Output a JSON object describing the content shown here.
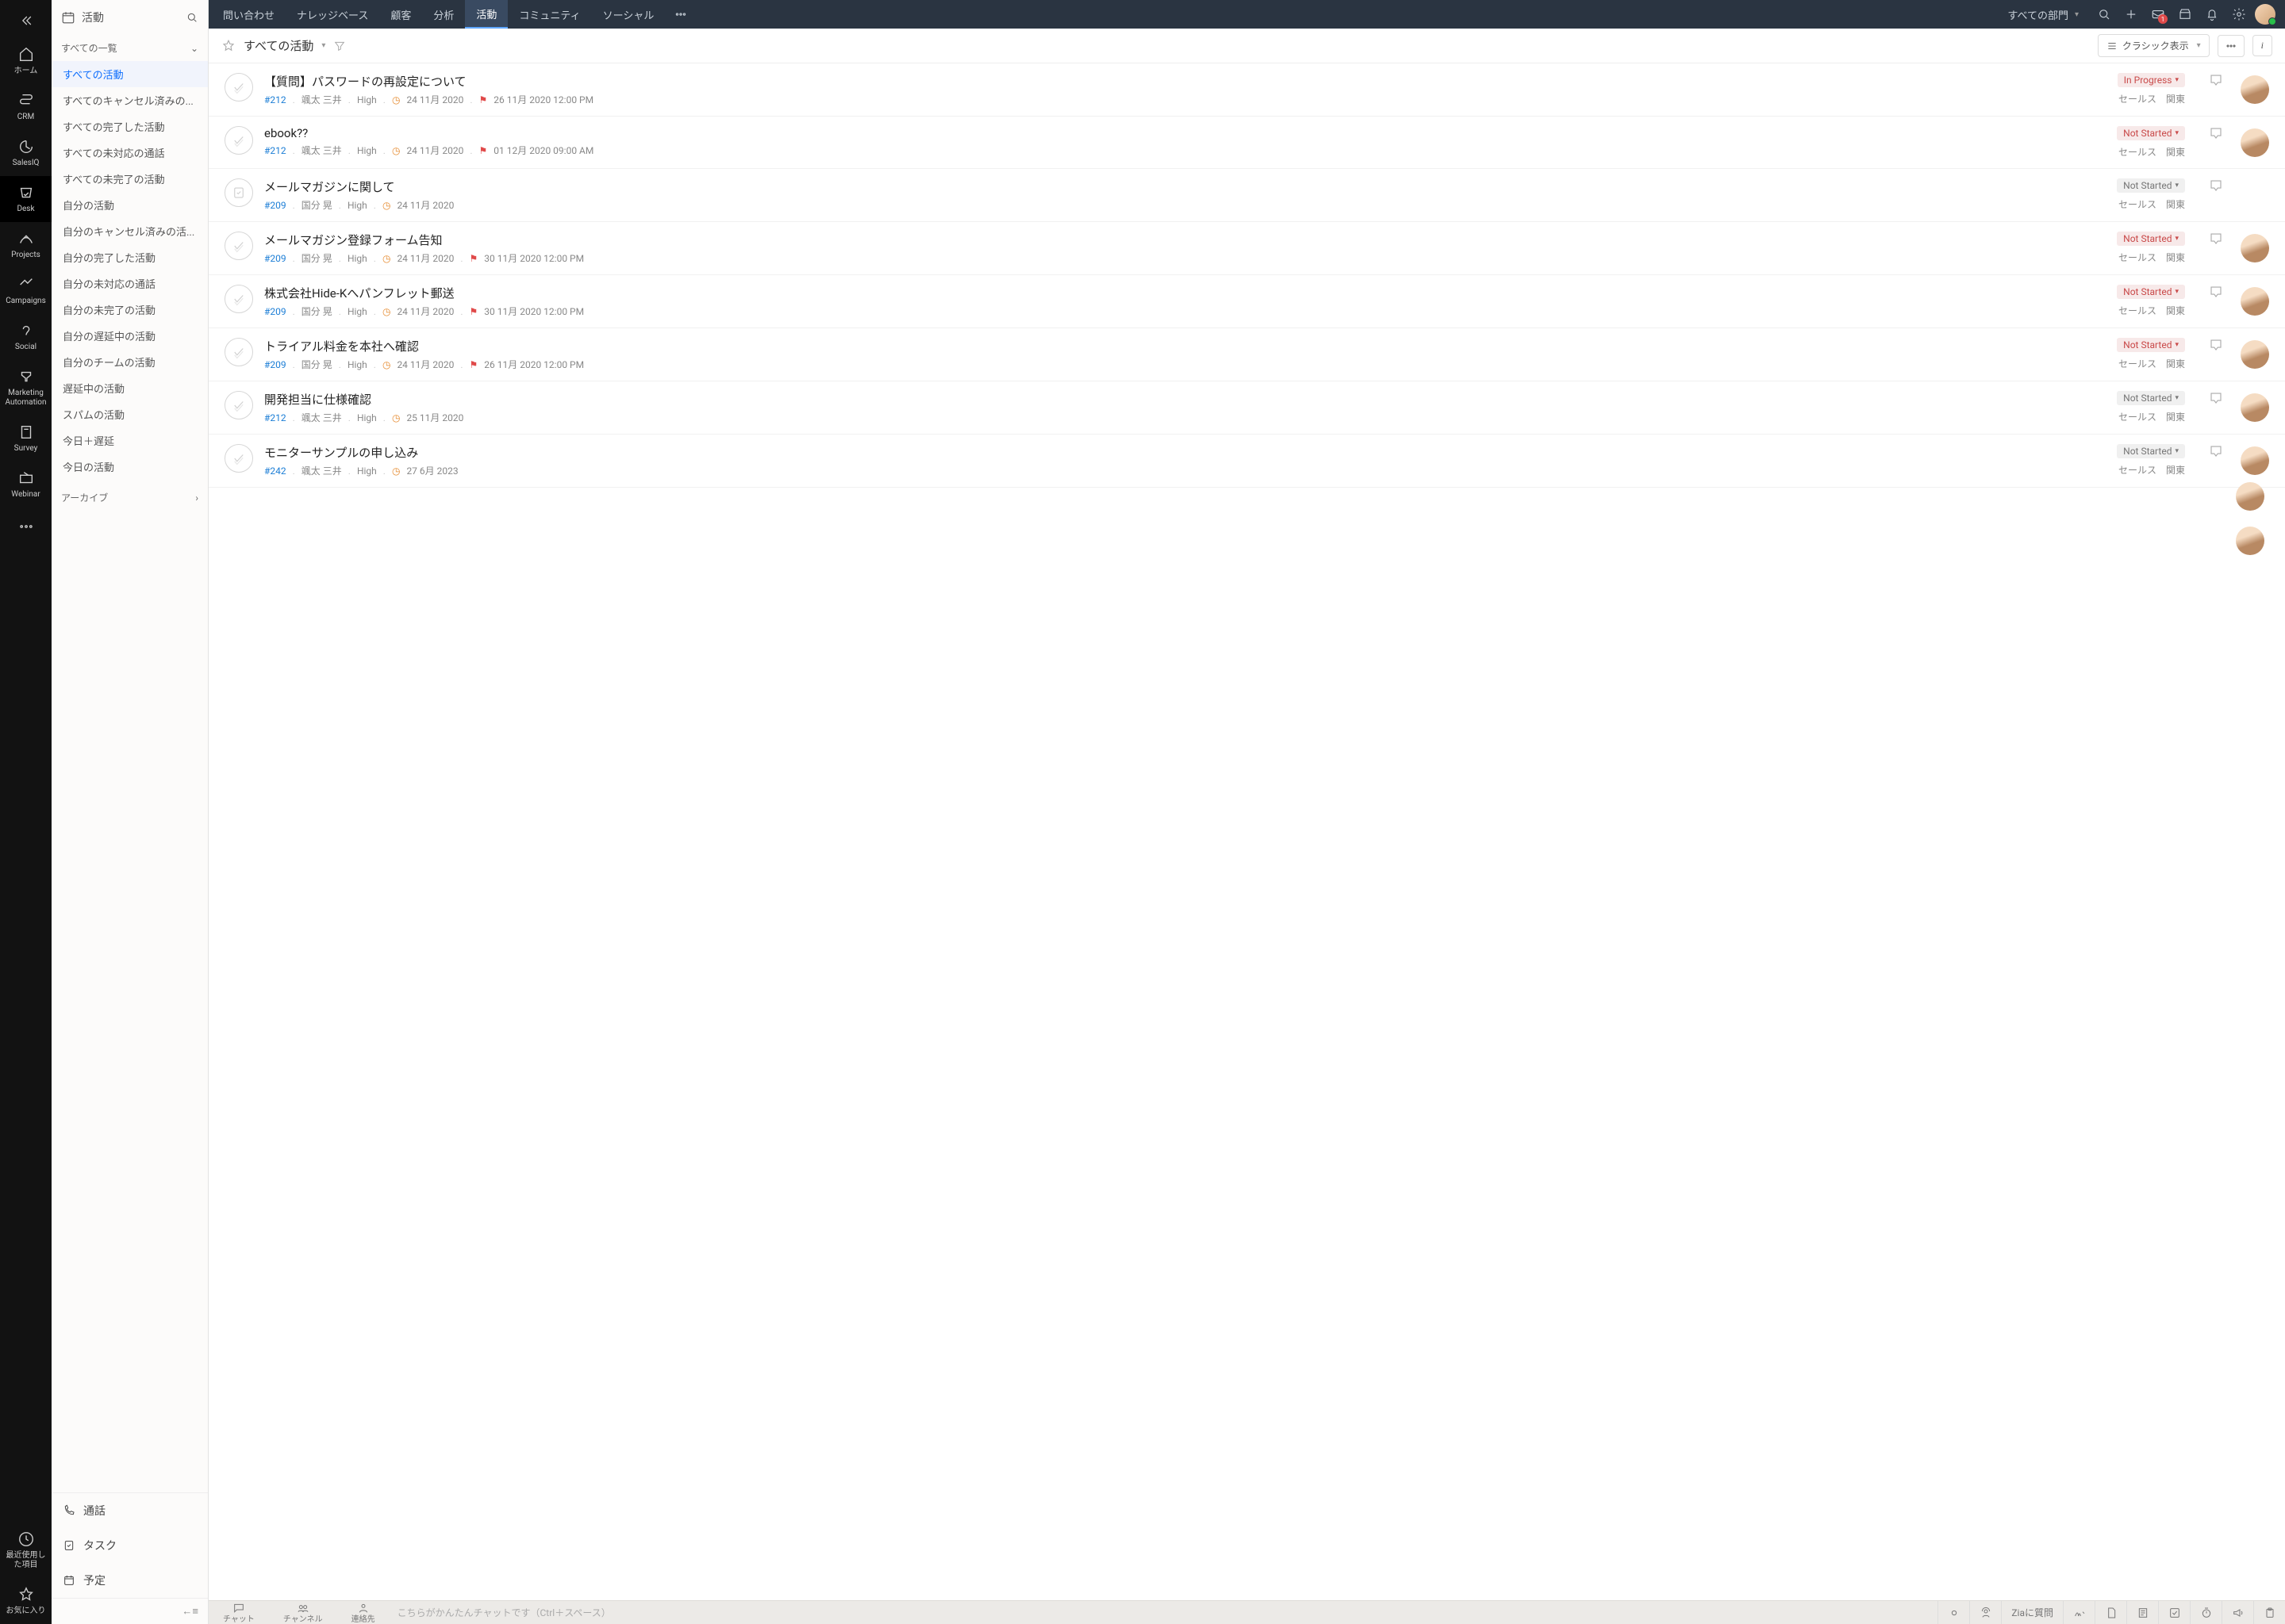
{
  "rail": {
    "items": [
      {
        "label": "ホーム"
      },
      {
        "label": "CRM"
      },
      {
        "label": "SalesIQ"
      },
      {
        "label": "Desk"
      },
      {
        "label": "Projects"
      },
      {
        "label": "Campaigns"
      },
      {
        "label": "Social"
      },
      {
        "label": "Marketing Automation"
      },
      {
        "label": "Survey"
      },
      {
        "label": "Webinar"
      }
    ],
    "recent": "最近使用した項目",
    "fav": "お気に入り"
  },
  "topbar": {
    "tabs": [
      "問い合わせ",
      "ナレッジベース",
      "顧客",
      "分析",
      "活動",
      "コミュニティ",
      "ソーシャル"
    ],
    "active_index": 4,
    "department": "すべての部門"
  },
  "sidebar": {
    "title": "活動",
    "group": "すべての一覧",
    "items": [
      "すべての活動",
      "すべてのキャンセル済みの...",
      "すべての完了した活動",
      "すべての未対応の通話",
      "すべての未完了の活動",
      "自分の活動",
      "自分のキャンセル済みの活...",
      "自分の完了した活動",
      "自分の未対応の通話",
      "自分の未完了の活動",
      "自分の遅延中の活動",
      "自分のチームの活動",
      "遅延中の活動",
      "スパムの活動",
      "今日＋遅延",
      "今日の活動"
    ],
    "selected_index": 0,
    "archive": "アーカイブ",
    "bottom": {
      "call": "通話",
      "task": "タスク",
      "event": "予定"
    }
  },
  "subbar": {
    "title": "すべての活動",
    "view": "クラシック表示"
  },
  "list": [
    {
      "title": "【質問】パスワードの再設定について",
      "id": "#212",
      "owner": "颯太 三井",
      "priority": "High",
      "date": "24 11月 2020",
      "due": "26 11月 2020 12:00 PM",
      "status": "In Progress",
      "status_red": true,
      "tags": "セールス　関東",
      "avatar": true
    },
    {
      "title": "ebook??",
      "id": "#212",
      "owner": "颯太 三井",
      "priority": "High",
      "date": "24 11月 2020",
      "due": "01 12月 2020 09:00 AM",
      "status": "Not Started",
      "status_red": true,
      "tags": "セールス　関東",
      "avatar": true
    },
    {
      "title": "メールマガジンに関して",
      "id": "#209",
      "owner": "国分 晃",
      "priority": "High",
      "date": "24 11月 2020",
      "due": "",
      "status": "Not Started",
      "status_red": false,
      "tags": "セールス　関東",
      "avatar": false,
      "task": true
    },
    {
      "title": "メールマガジン登録フォーム告知",
      "id": "#209",
      "owner": "国分 晃",
      "priority": "High",
      "date": "24 11月 2020",
      "due": "30 11月 2020 12:00 PM",
      "status": "Not Started",
      "status_red": true,
      "tags": "セールス　関東",
      "avatar": true
    },
    {
      "title": "株式会社Hide-Kへパンフレット郵送",
      "id": "#209",
      "owner": "国分 晃",
      "priority": "High",
      "date": "24 11月 2020",
      "due": "30 11月 2020 12:00 PM",
      "status": "Not Started",
      "status_red": true,
      "tags": "セールス　関東",
      "avatar": true
    },
    {
      "title": "トライアル料金を本社へ確認",
      "id": "#209",
      "owner": "国分 晃",
      "priority": "High",
      "date": "24 11月 2020",
      "due": "26 11月 2020 12:00 PM",
      "status": "Not Started",
      "status_red": true,
      "tags": "セールス　関東",
      "avatar": true
    },
    {
      "title": "開発担当に仕様確認",
      "id": "#212",
      "owner": "颯太 三井",
      "priority": "High",
      "date": "25 11月 2020",
      "due": "",
      "status": "Not Started",
      "status_red": false,
      "tags": "セールス　関東",
      "avatar": true
    },
    {
      "title": "モニターサンプルの申し込み",
      "id": "#242",
      "owner": "颯太 三井",
      "priority": "High",
      "date": "27 6月 2023",
      "due": "",
      "status": "Not Started",
      "status_red": false,
      "tags": "セールス　関東",
      "avatar": true
    }
  ],
  "footer": {
    "tabs": [
      "チャット",
      "チャンネル",
      "連絡先"
    ],
    "placeholder": "こちらがかんたんチャットです（Ctrl＋スペース）",
    "zia": "Ziaに質問"
  }
}
